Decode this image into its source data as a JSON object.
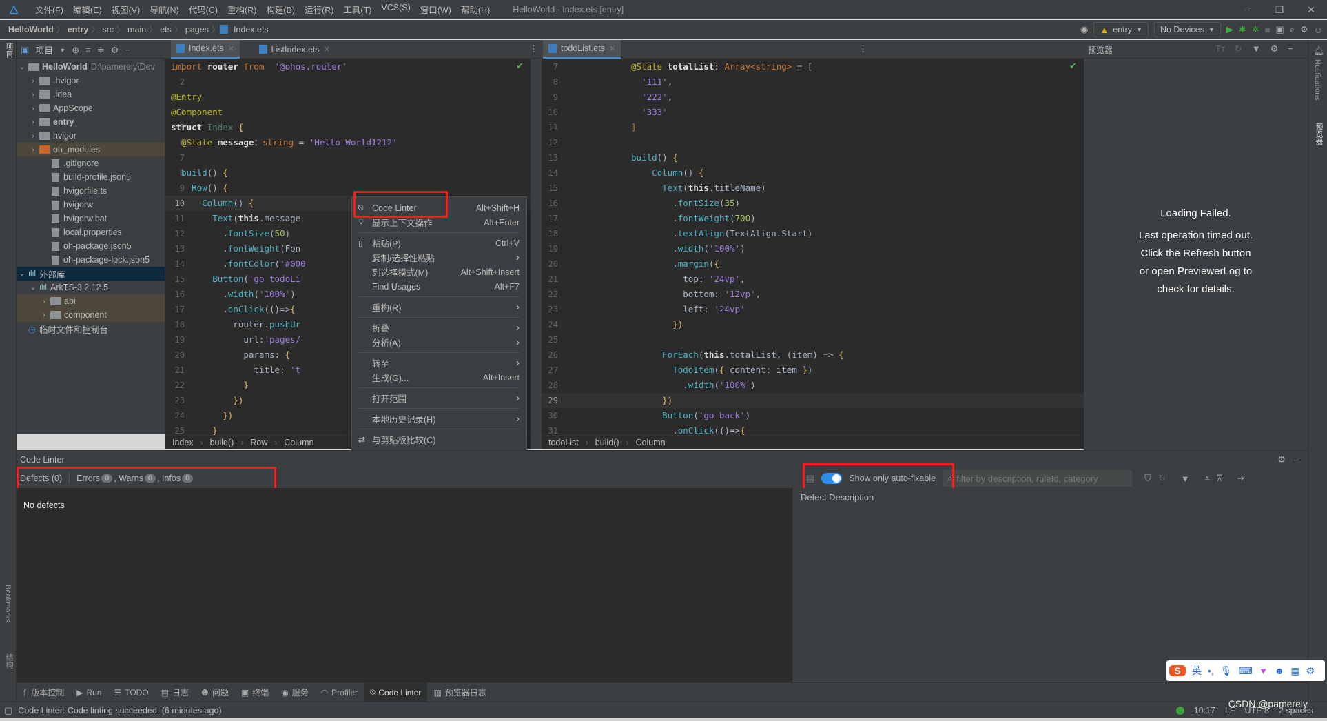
{
  "titlebar": {
    "menus": [
      "文件(F)",
      "编辑(E)",
      "视图(V)",
      "导航(N)",
      "代码(C)",
      "重构(R)",
      "构建(B)",
      "运行(R)",
      "工具(T)",
      "VCS(S)",
      "窗口(W)",
      "帮助(H)"
    ],
    "window_title": "HelloWorld - Index.ets [entry]",
    "minimize": "−",
    "restore": "❐",
    "close": "✕"
  },
  "navbar": {
    "breadcrumbs": [
      "HelloWorld",
      "entry",
      "src",
      "main",
      "ets",
      "pages",
      "Index.ets"
    ],
    "run_config": "entry",
    "device": "No Devices"
  },
  "left_stripe": {
    "project_label": "项目",
    "bookmarks_label": "Bookmarks",
    "structure_label": "结构"
  },
  "right_stripe": {
    "notifications_label": "Notifications",
    "previewer_label": "预览器"
  },
  "project_panel": {
    "title": "项目",
    "tree": [
      {
        "label": "HelloWorld",
        "suffix": "D:\\pamerely\\Dev",
        "level": 0,
        "arrow": "⌄",
        "icon": "module",
        "bold": true
      },
      {
        "label": ".hvigor",
        "level": 1,
        "arrow": "›",
        "icon": "folder"
      },
      {
        "label": ".idea",
        "level": 1,
        "arrow": "›",
        "icon": "folder"
      },
      {
        "label": "AppScope",
        "level": 1,
        "arrow": "›",
        "icon": "folder"
      },
      {
        "label": "entry",
        "level": 1,
        "arrow": "›",
        "icon": "module",
        "bold": true
      },
      {
        "label": "hvigor",
        "level": 1,
        "arrow": "›",
        "icon": "folder"
      },
      {
        "label": "oh_modules",
        "level": 1,
        "arrow": "›",
        "icon": "folder-orange",
        "highlight": true
      },
      {
        "label": ".gitignore",
        "level": 2,
        "icon": "file"
      },
      {
        "label": "build-profile.json5",
        "level": 2,
        "icon": "file"
      },
      {
        "label": "hvigorfile.ts",
        "level": 2,
        "icon": "file"
      },
      {
        "label": "hvigorw",
        "level": 2,
        "icon": "file"
      },
      {
        "label": "hvigorw.bat",
        "level": 2,
        "icon": "file"
      },
      {
        "label": "local.properties",
        "level": 2,
        "icon": "file"
      },
      {
        "label": "oh-package.json5",
        "level": 2,
        "icon": "file"
      },
      {
        "label": "oh-package-lock.json5",
        "level": 2,
        "icon": "file"
      },
      {
        "label": "外部库",
        "level": 0,
        "arrow": "⌄",
        "icon": "library",
        "selected": true
      },
      {
        "label": "ArkTS-3.2.12.5",
        "level": 1,
        "arrow": "⌄",
        "icon": "library"
      },
      {
        "label": "api",
        "level": 2,
        "arrow": "›",
        "icon": "folder",
        "highlight": true
      },
      {
        "label": "component",
        "level": 2,
        "arrow": "›",
        "icon": "folder",
        "highlight": true
      },
      {
        "label": "临时文件和控制台",
        "level": 0,
        "icon": "console"
      }
    ]
  },
  "tabs_left": [
    {
      "label": "Index.ets",
      "active": true
    },
    {
      "label": "ListIndex.ets",
      "active": false
    }
  ],
  "tabs_right": [
    {
      "label": "todoList.ets",
      "active": true
    }
  ],
  "editor_left": {
    "current_line": 10,
    "lines": [
      {
        "n": 1,
        "seg": [
          [
            "k",
            "import "
          ],
          [
            "w",
            "router "
          ],
          [
            "k",
            "from  "
          ],
          [
            "s",
            "'@ohos.router'"
          ]
        ]
      },
      {
        "n": 2,
        "seg": []
      },
      {
        "n": 3,
        "seg": [
          [
            "a",
            "@Entry"
          ]
        ]
      },
      {
        "n": 4,
        "seg": [
          [
            "a",
            "@Component"
          ]
        ]
      },
      {
        "n": 5,
        "seg": [
          [
            "w",
            "struct "
          ],
          [
            "t",
            "Index "
          ],
          [
            "y",
            "{"
          ]
        ]
      },
      {
        "n": 6,
        "seg": [
          [
            "",
            "  "
          ],
          [
            "a",
            "@State "
          ],
          [
            "w",
            "message"
          ],
          [
            "",
            "："
          ],
          [
            "k",
            "string"
          ],
          [
            "",
            " = "
          ],
          [
            "s",
            "'Hello World1212'"
          ]
        ]
      },
      {
        "n": 7,
        "seg": []
      },
      {
        "n": 8,
        "seg": [
          [
            "",
            "  "
          ],
          [
            "f",
            "build"
          ],
          [
            "",
            "() "
          ],
          [
            "y",
            "{"
          ]
        ]
      },
      {
        "n": 9,
        "seg": [
          [
            "",
            "    "
          ],
          [
            "f",
            "Row"
          ],
          [
            "",
            "() "
          ],
          [
            "y",
            "{"
          ]
        ]
      },
      {
        "n": 10,
        "seg": [
          [
            "",
            "      "
          ],
          [
            "f",
            "Column"
          ],
          [
            "",
            "() "
          ],
          [
            "y",
            "{"
          ]
        ]
      },
      {
        "n": 11,
        "seg": [
          [
            "",
            "        "
          ],
          [
            "f",
            "Text"
          ],
          [
            "",
            "("
          ],
          [
            "w",
            "this"
          ],
          [
            "",
            ".message"
          ]
        ]
      },
      {
        "n": 12,
        "seg": [
          [
            "",
            "          ."
          ],
          [
            "f",
            "fontSize"
          ],
          [
            "",
            "("
          ],
          [
            "n",
            "50"
          ],
          [
            "",
            ")"
          ]
        ]
      },
      {
        "n": 13,
        "seg": [
          [
            "",
            "          ."
          ],
          [
            "f",
            "fontWeight"
          ],
          [
            "",
            "(Fon"
          ]
        ]
      },
      {
        "n": 14,
        "seg": [
          [
            "",
            "          ."
          ],
          [
            "f",
            "fontColor"
          ],
          [
            "",
            "("
          ],
          [
            "s",
            "'#000"
          ]
        ]
      },
      {
        "n": 15,
        "seg": [
          [
            "",
            "        "
          ],
          [
            "f",
            "Button"
          ],
          [
            "",
            "("
          ],
          [
            "s",
            "'go todoLi"
          ]
        ]
      },
      {
        "n": 16,
        "seg": [
          [
            "",
            "          ."
          ],
          [
            "f",
            "width"
          ],
          [
            "",
            "("
          ],
          [
            "s",
            "'100%'"
          ],
          [
            "",
            ")"
          ]
        ]
      },
      {
        "n": 17,
        "seg": [
          [
            "",
            "          ."
          ],
          [
            "f",
            "onClick"
          ],
          [
            "",
            "(()=>"
          ],
          [
            "y",
            "{"
          ]
        ]
      },
      {
        "n": 18,
        "seg": [
          [
            "",
            "            router."
          ],
          [
            "f",
            "pushUr"
          ]
        ]
      },
      {
        "n": 19,
        "seg": [
          [
            "",
            "              url:"
          ],
          [
            "s",
            "'pages/"
          ]
        ]
      },
      {
        "n": 20,
        "seg": [
          [
            "",
            "              params: "
          ],
          [
            "y",
            "{"
          ]
        ]
      },
      {
        "n": 21,
        "seg": [
          [
            "",
            "                title: "
          ],
          [
            "s",
            "'t"
          ]
        ]
      },
      {
        "n": 22,
        "seg": [
          [
            "",
            "              "
          ],
          [
            "y",
            "}"
          ]
        ]
      },
      {
        "n": 23,
        "seg": [
          [
            "",
            "            "
          ],
          [
            "y",
            "})"
          ]
        ]
      },
      {
        "n": 24,
        "seg": [
          [
            "",
            "          "
          ],
          [
            "y",
            "})"
          ]
        ]
      },
      {
        "n": 25,
        "seg": [
          [
            "",
            "        "
          ],
          [
            "y",
            "}"
          ]
        ]
      }
    ],
    "breadcrumb": [
      "Index",
      "build()",
      "Row",
      "Column"
    ]
  },
  "editor_right": {
    "current_line": 29,
    "lines": [
      {
        "n": 7,
        "seg": [
          [
            "a",
            "@State "
          ],
          [
            "w",
            "totalList"
          ],
          [
            "",
            ": "
          ],
          [
            "k",
            "Array<string>"
          ],
          [
            "",
            " = ["
          ]
        ]
      },
      {
        "n": 8,
        "seg": [
          [
            "",
            "  "
          ],
          [
            "s",
            "'111'"
          ],
          [
            "",
            ","
          ]
        ]
      },
      {
        "n": 9,
        "seg": [
          [
            "",
            "  "
          ],
          [
            "s",
            "'222'"
          ],
          [
            "",
            ","
          ]
        ]
      },
      {
        "n": 10,
        "seg": [
          [
            "",
            "  "
          ],
          [
            "s",
            "'333'"
          ]
        ]
      },
      {
        "n": 11,
        "seg": [
          [
            "k",
            "]"
          ]
        ]
      },
      {
        "n": 12,
        "seg": []
      },
      {
        "n": 13,
        "seg": [
          [
            "f",
            "build"
          ],
          [
            "",
            "() "
          ],
          [
            "y",
            "{"
          ]
        ]
      },
      {
        "n": 14,
        "seg": [
          [
            "",
            "    "
          ],
          [
            "f",
            "Column"
          ],
          [
            "",
            "() "
          ],
          [
            "y",
            "{"
          ]
        ]
      },
      {
        "n": 15,
        "seg": [
          [
            "",
            "      "
          ],
          [
            "f",
            "Text"
          ],
          [
            "",
            "("
          ],
          [
            "w",
            "this"
          ],
          [
            "",
            ".titleName)"
          ]
        ]
      },
      {
        "n": 16,
        "seg": [
          [
            "",
            "        ."
          ],
          [
            "f",
            "fontSize"
          ],
          [
            "",
            "("
          ],
          [
            "n",
            "35"
          ],
          [
            "",
            ")"
          ]
        ]
      },
      {
        "n": 17,
        "seg": [
          [
            "",
            "        ."
          ],
          [
            "f",
            "fontWeight"
          ],
          [
            "",
            "("
          ],
          [
            "n",
            "700"
          ],
          [
            "",
            ")"
          ]
        ]
      },
      {
        "n": 18,
        "seg": [
          [
            "",
            "        ."
          ],
          [
            "f",
            "textAlign"
          ],
          [
            "",
            "(TextAlign.Start)"
          ]
        ]
      },
      {
        "n": 19,
        "seg": [
          [
            "",
            "        ."
          ],
          [
            "f",
            "width"
          ],
          [
            "",
            "("
          ],
          [
            "s",
            "'100%'"
          ],
          [
            "",
            ")"
          ]
        ]
      },
      {
        "n": 20,
        "seg": [
          [
            "",
            "        ."
          ],
          [
            "f",
            "margin"
          ],
          [
            "",
            "("
          ],
          [
            "y",
            "{"
          ]
        ]
      },
      {
        "n": 21,
        "seg": [
          [
            "",
            "          top: "
          ],
          [
            "s",
            "'24vp'"
          ],
          [
            "",
            ","
          ]
        ]
      },
      {
        "n": 22,
        "seg": [
          [
            "",
            "          bottom: "
          ],
          [
            "s",
            "'12vp'"
          ],
          [
            "",
            ","
          ]
        ]
      },
      {
        "n": 23,
        "seg": [
          [
            "",
            "          left: "
          ],
          [
            "s",
            "'24vp'"
          ]
        ]
      },
      {
        "n": 24,
        "seg": [
          [
            "",
            "        "
          ],
          [
            "y",
            "})"
          ]
        ]
      },
      {
        "n": 25,
        "seg": []
      },
      {
        "n": 26,
        "seg": [
          [
            "",
            "      "
          ],
          [
            "f",
            "ForEach"
          ],
          [
            "",
            "("
          ],
          [
            "w",
            "this"
          ],
          [
            "",
            ".totalList, (item) => "
          ],
          [
            "y",
            "{"
          ]
        ]
      },
      {
        "n": 27,
        "seg": [
          [
            "",
            "        "
          ],
          [
            "f",
            "TodoItem"
          ],
          [
            "",
            "("
          ],
          [
            "y",
            "{"
          ],
          [
            "",
            " content: item "
          ],
          [
            "y",
            "}"
          ],
          [
            "",
            ")"
          ]
        ]
      },
      {
        "n": 28,
        "seg": [
          [
            "",
            "          ."
          ],
          [
            "f",
            "width"
          ],
          [
            "",
            "("
          ],
          [
            "s",
            "'100%'"
          ],
          [
            "",
            ")"
          ]
        ]
      },
      {
        "n": 29,
        "seg": [
          [
            "",
            "      "
          ],
          [
            "y",
            "})"
          ]
        ]
      },
      {
        "n": 30,
        "seg": [
          [
            "",
            "      "
          ],
          [
            "f",
            "Button"
          ],
          [
            "",
            "("
          ],
          [
            "s",
            "'go back'"
          ],
          [
            "",
            ")"
          ]
        ]
      },
      {
        "n": 31,
        "seg": [
          [
            "",
            "        ."
          ],
          [
            "f",
            "onClick"
          ],
          [
            "",
            "(()=>"
          ],
          [
            "y",
            "{"
          ]
        ]
      }
    ],
    "breadcrumb": [
      "todoList",
      "build()",
      "Column"
    ]
  },
  "previewer": {
    "title": "预览器",
    "messages": [
      "Loading Failed.",
      "Last operation timed out.",
      "Click the Refresh button",
      "or open PreviewerLog to",
      "check for details."
    ]
  },
  "context_menu": {
    "items": [
      {
        "label": "Code Linter",
        "shortcut": "Alt+Shift+H",
        "icon": "code-linter-icon"
      },
      {
        "label": "显示上下文操作",
        "shortcut": "Alt+Enter",
        "icon": "bulb-icon"
      },
      {
        "sep": true
      },
      {
        "label": "粘贴(P)",
        "shortcut": "Ctrl+V",
        "icon": "clipboard-icon"
      },
      {
        "label": "复制/选择性粘贴",
        "submenu": true
      },
      {
        "label": "列选择模式(M)",
        "shortcut": "Alt+Shift+Insert"
      },
      {
        "label": "Find Usages",
        "shortcut": "Alt+F7"
      },
      {
        "sep": true
      },
      {
        "label": "重构(R)",
        "submenu": true
      },
      {
        "sep": true
      },
      {
        "label": "折叠",
        "submenu": true
      },
      {
        "label": "分析(A)",
        "submenu": true
      },
      {
        "sep": true
      },
      {
        "label": "转至",
        "submenu": true
      },
      {
        "label": "生成(G)...",
        "shortcut": "Alt+Insert"
      },
      {
        "sep": true
      },
      {
        "label": "打开范围",
        "submenu": true
      },
      {
        "sep": true
      },
      {
        "label": "本地历史记录(H)",
        "submenu": true
      },
      {
        "sep": true
      },
      {
        "label": "与剪贴板比较(C)",
        "icon": "compare-icon"
      }
    ]
  },
  "code_linter": {
    "title": "Code Linter",
    "defects_label": "Defects (0)",
    "errors_label": "Errors",
    "errors_count": "0",
    "warns_label": "Warns",
    "warns_count": "0",
    "infos_label": "Infos",
    "infos_count": "0",
    "empty_text": "No defects",
    "toggle_label": "Show only auto-fixable",
    "toggle_on": true,
    "filter_placeholder": "filter by description, ruleId, category",
    "detail_header": "Defect Description"
  },
  "tool_windows": [
    {
      "label": "版本控制",
      "icon": "vcs-icon"
    },
    {
      "label": "Run",
      "icon": "run-icon"
    },
    {
      "label": "TODO",
      "icon": "todo-icon"
    },
    {
      "label": "日志",
      "icon": "log-icon"
    },
    {
      "label": "问题",
      "icon": "problems-icon"
    },
    {
      "label": "终端",
      "icon": "terminal-icon"
    },
    {
      "label": "服务",
      "icon": "services-icon"
    },
    {
      "label": "Profiler",
      "icon": "profiler-icon"
    },
    {
      "label": "Code Linter",
      "icon": "code-linter-icon",
      "active": true
    },
    {
      "label": "预览器日志",
      "icon": "previewer-log-icon"
    }
  ],
  "statusbar": {
    "message": "Code Linter: Code linting succeeded. (6 minutes ago)",
    "position": "10:17",
    "line_sep": "LF",
    "encoding": "UTF-8",
    "indent": "2 spaces",
    "watermark": "CSDN @pamerely"
  },
  "ime": {
    "mode": "英",
    "punct": "•,"
  },
  "colors": {
    "accent": "#2f8ee8",
    "highlight_box": "#ff1a1a",
    "editor_bg": "#2b2b2b",
    "panel_bg": "#3c3f41"
  }
}
